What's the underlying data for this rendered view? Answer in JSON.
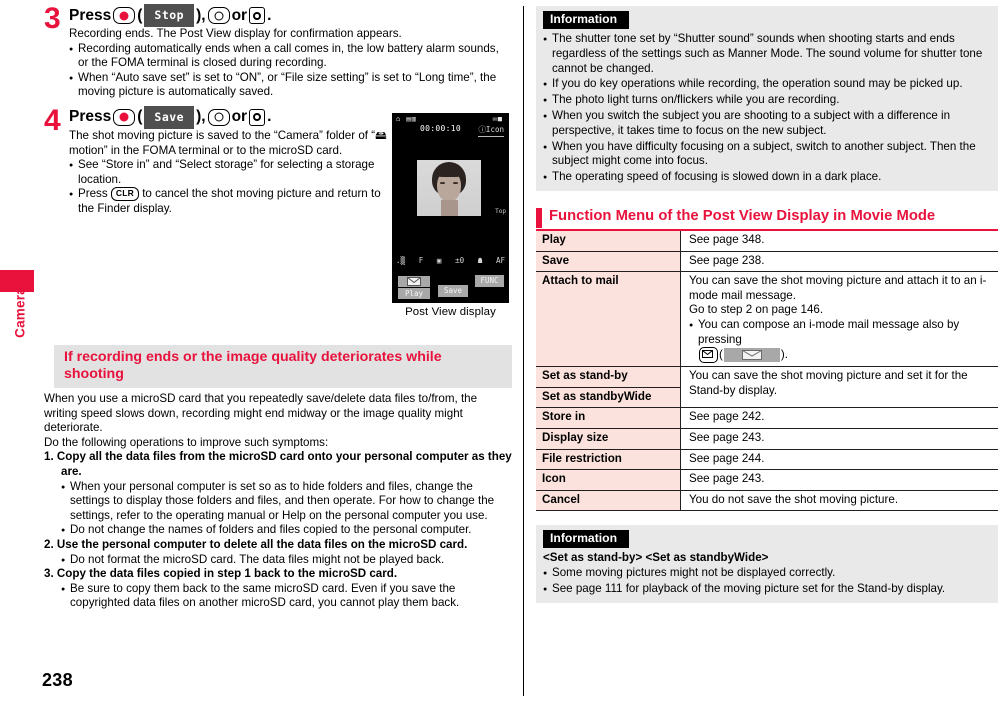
{
  "page": {
    "number": "238",
    "side_tab": "Camera"
  },
  "left": {
    "step3": {
      "num": "3",
      "head_prefix": "Press",
      "key_softlabel": "Stop",
      "head_or": "or",
      "head_suffix": ".",
      "intro": "Recording ends. The Post View display for confirmation appears.",
      "bullets": [
        "Recording automatically ends when a call comes in, the low battery alarm sounds, or the FOMA terminal is closed during recording.",
        "When “Auto save set” is set to “ON”, or “File size setting” is set to “Long time”, the moving picture is automatically saved."
      ]
    },
    "step4": {
      "num": "4",
      "head_prefix": "Press",
      "key_softlabel": "Save",
      "head_or": "or",
      "head_suffix": ".",
      "intro_a": "The shot moving picture is saved to the “Camera” folder of “",
      "intro_b": " motion” in the FOMA terminal or to the microSD card.",
      "bullets": [
        "See “Store in” and “Select storage” for selecting a storage location."
      ],
      "bullet_clr_a": "Press",
      "bullet_clr_key": "CLR",
      "bullet_clr_b": "to cancel the shot moving picture and return to the Finder display."
    },
    "phone": {
      "caption": "Post View display",
      "status_left": "⌂ ▤▥",
      "status_right": "✉■",
      "time": "00:00:10",
      "icon_label": "ⓘIcon",
      "top_marker": "Top",
      "icon_row": [
        ".▒",
        "F",
        "▣",
        "±0",
        "☗",
        "AF"
      ],
      "softkey_play": "Play",
      "softkey_save": "Save",
      "softkey_func": "FUNC"
    },
    "section_heading": "If recording ends or the image quality deteriorates while shooting",
    "body": {
      "p1": "When you use a microSD card that you repeatedly save/delete data files to/from, the writing speed slows down, recording might end midway or the image quality might deteriorate.",
      "p2": "Do the following operations to improve such symptoms:",
      "items": [
        {
          "num": "1.",
          "text": "Copy all the data files from the microSD card onto your personal computer as they are.",
          "bullets": [
            "When your personal computer is set so as to hide folders and files, change the settings to display those folders and files, and then operate. For how to change the settings, refer to the operating manual or Help on the personal computer you use.",
            "Do not change the names of folders and files copied to the personal computer."
          ]
        },
        {
          "num": "2.",
          "text": "Use the personal computer to delete all the data files on the microSD card.",
          "bullets": [
            "Do not format the microSD card. The data files might not be played back."
          ]
        },
        {
          "num": "3.",
          "text": "Copy the data files copied in step 1 back to the microSD card.",
          "bullets": [
            "Be sure to copy them back to the same microSD card. Even if you save the copyrighted data files on another microSD card, you cannot play them back."
          ]
        }
      ]
    }
  },
  "right": {
    "info_top": {
      "tag": "Information",
      "bullets": [
        "The shutter tone set by “Shutter sound” sounds when shooting starts and ends regardless of the settings such as Manner Mode. The sound volume for shutter tone cannot be changed.",
        "If you do key operations while recording, the operation sound may be picked up.",
        "The photo light turns on/flickers while you are recording.",
        "When you switch the subject you are shooting to a subject with a difference in perspective, it takes time to focus on the new subject.",
        "When you have difficulty focusing on a subject, switch to another subject. Then the subject might come into focus.",
        "The operating speed of focusing is slowed down in a dark place."
      ]
    },
    "func_menu": {
      "title": "Function Menu of the Post View Display in Movie Mode",
      "rows": [
        {
          "label": "Play",
          "desc": "See page 348."
        },
        {
          "label": "Save",
          "desc": "See page 238."
        },
        {
          "label": "Attach to mail",
          "desc_line1": "You can save the shot moving picture and attach it to an i-mode mail message.",
          "desc_line2": "Go to step 2 on page 146.",
          "desc_bullet_a": "You can compose an i-mode mail message also by pressing",
          "desc_bullet_b": ")."
        },
        {
          "label": "Set as stand-by",
          "desc_merged": "You can save the shot moving picture and set it for the Stand-by display."
        },
        {
          "label": "Set as standbyWide",
          "desc_merged_cont": ""
        },
        {
          "label": "Store in",
          "desc": "See page 242."
        },
        {
          "label": "Display size",
          "desc": "See page 243."
        },
        {
          "label": "File restriction",
          "desc": "See page 244."
        },
        {
          "label": "Icon",
          "desc": "See page 243."
        },
        {
          "label": "Cancel",
          "desc": "You do not save the shot moving picture."
        }
      ]
    },
    "info_bottom": {
      "tag": "Information",
      "subtitle": "<Set as stand-by> <Set as standbyWide>",
      "bullets": [
        "Some moving pictures might not be displayed correctly.",
        "See page 111 for playback of the moving picture set for the Stand-by display."
      ]
    }
  },
  "colors": {
    "accent_red": "#e8123c",
    "table_label_bg": "#fbe2dc",
    "info_bg": "#e9e9e9",
    "heading_bg": "#e2e2e2"
  }
}
